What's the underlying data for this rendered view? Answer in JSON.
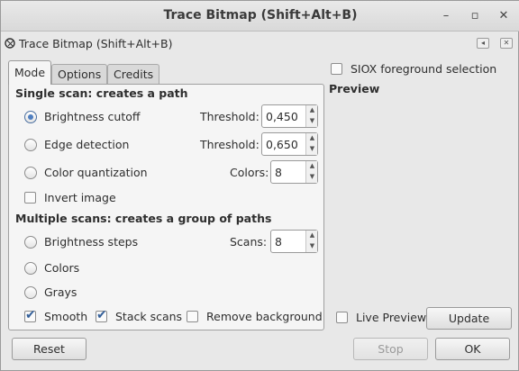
{
  "window": {
    "title": "Trace Bitmap (Shift+Alt+B)",
    "controls": [
      "–",
      "▫",
      "✕"
    ]
  },
  "dock": {
    "title": "Trace Bitmap (Shift+Alt+B)",
    "buttons": [
      "◂",
      "✕"
    ]
  },
  "tabs": [
    {
      "label": "Mode",
      "active": true
    },
    {
      "label": "Options",
      "active": false
    },
    {
      "label": "Credits",
      "active": false
    }
  ],
  "single_scan": {
    "heading": "Single scan: creates a path",
    "brightness": {
      "label": "Brightness cutoff",
      "selected": true,
      "field_label": "Threshold:",
      "value": "0,450"
    },
    "edge": {
      "label": "Edge detection",
      "selected": false,
      "field_label": "Threshold:",
      "value": "0,650"
    },
    "color_quant": {
      "label": "Color quantization",
      "selected": false,
      "field_label": "Colors:",
      "value": "8"
    },
    "invert": {
      "label": "Invert image",
      "checked": false
    }
  },
  "multi_scan": {
    "heading": "Multiple scans: creates a group of paths",
    "brightness_steps": {
      "label": "Brightness steps",
      "selected": false,
      "field_label": "Scans:",
      "value": "8"
    },
    "colors": {
      "label": "Colors",
      "selected": false
    },
    "grays": {
      "label": "Grays",
      "selected": false
    },
    "smooth": {
      "label": "Smooth",
      "checked": true
    },
    "stack": {
      "label": "Stack scans",
      "checked": true
    },
    "remove_bg": {
      "label": "Remove background",
      "checked": false
    }
  },
  "right": {
    "siox": {
      "label": "SIOX foreground selection",
      "checked": false
    },
    "preview_title": "Preview",
    "live_preview": {
      "label": "Live Preview",
      "checked": false
    },
    "update_label": "Update"
  },
  "footer": {
    "reset_label": "Reset",
    "stop_label": "Stop",
    "ok_label": "OK"
  },
  "tick_glyph": "✔",
  "spin_up": "▲",
  "spin_down": "▼"
}
